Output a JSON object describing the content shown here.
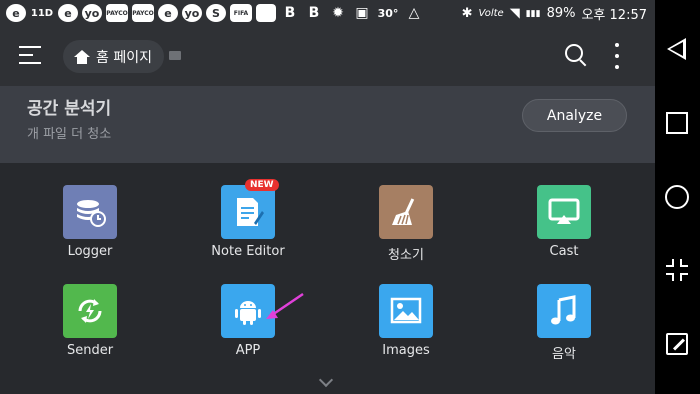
{
  "statusbar": {
    "left_icons": [
      {
        "name": "e-app-icon",
        "text": "e"
      },
      {
        "name": "lte-indicator-icon",
        "text": "11D"
      },
      {
        "name": "e-app-icon-2",
        "text": "e"
      },
      {
        "name": "yo-app-icon",
        "text": "yo"
      },
      {
        "name": "payco-app-icon",
        "text": "PAYCO"
      },
      {
        "name": "payco-app-icon-2",
        "text": "PAYCO"
      },
      {
        "name": "e-app-icon-3",
        "text": "e"
      },
      {
        "name": "yo-app-icon-2",
        "text": "yo"
      },
      {
        "name": "s-app-icon",
        "text": "S"
      },
      {
        "name": "fifa-app-icon",
        "text": "FIFA"
      },
      {
        "name": "blank-app-icon",
        "text": ""
      },
      {
        "name": "b-app-icon",
        "text": "B"
      },
      {
        "name": "b-app-icon-2",
        "text": "B"
      },
      {
        "name": "android-bug-icon",
        "text": "✹"
      },
      {
        "name": "image-icon",
        "text": "▣"
      },
      {
        "name": "temperature-icon",
        "text": "30°"
      },
      {
        "name": "drive-icon",
        "text": "△"
      }
    ],
    "bluetooth": "✱",
    "network": "Volte",
    "wifi": "◥",
    "signal": "▮▮▮",
    "battery": "89%",
    "time": "오후 12:57"
  },
  "appbar": {
    "home_label": "홈 페이지",
    "search_icon": "search-icon",
    "more_icon": "more-vert-icon"
  },
  "space_card": {
    "title": "공간 분석기",
    "subtitle": "개 파일 더 청소",
    "analyze_label": "Analyze"
  },
  "tiles": [
    {
      "name": "logger",
      "label": "Logger",
      "color": "#6f7fb5",
      "glyph": "≋",
      "badge": ""
    },
    {
      "name": "note-editor",
      "label": "Note Editor",
      "color": "#3da5ea",
      "glyph": "✎",
      "badge": "NEW"
    },
    {
      "name": "cleaner",
      "label": "청소기",
      "color": "#a67f63",
      "glyph": "⚱",
      "badge": ""
    },
    {
      "name": "cast",
      "label": "Cast",
      "color": "#45c289",
      "glyph": "▭",
      "badge": ""
    },
    {
      "name": "sender",
      "label": "Sender",
      "color": "#52b84d",
      "glyph": "↻",
      "badge": ""
    },
    {
      "name": "app",
      "label": "APP",
      "color": "#3aa7ee",
      "glyph": "◍",
      "badge": ""
    },
    {
      "name": "images",
      "label": "Images",
      "color": "#3aa7ee",
      "glyph": "▨",
      "badge": ""
    },
    {
      "name": "music",
      "label": "음악",
      "color": "#3aa7ee",
      "glyph": "♫",
      "badge": ""
    }
  ],
  "colors": {
    "background": "#27292d",
    "appbar": "#2f3135",
    "card": "#3c3f46",
    "arrow": "#e040d9"
  }
}
